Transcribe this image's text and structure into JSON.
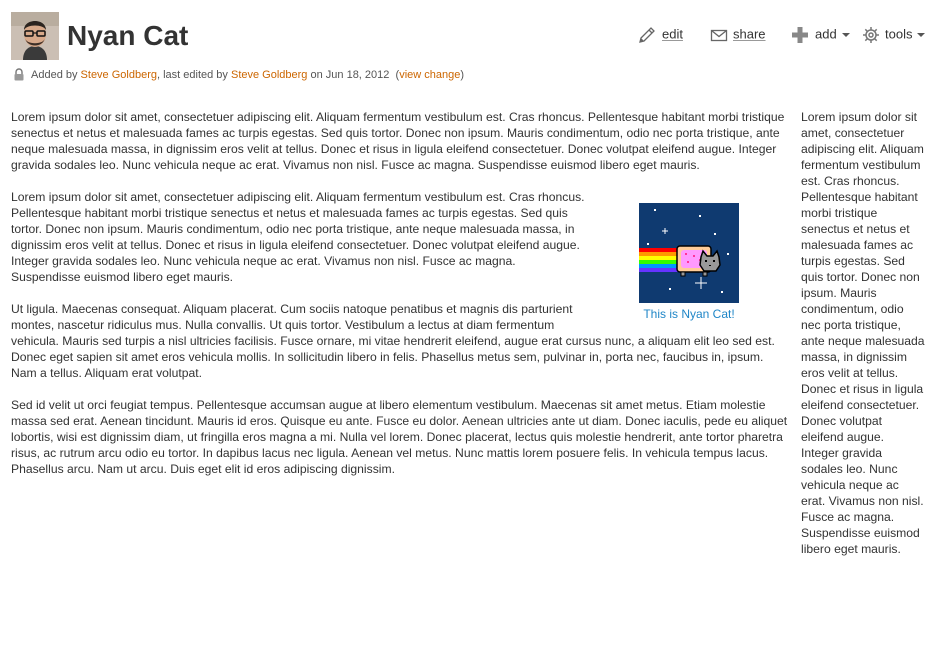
{
  "page": {
    "title": "Nyan Cat"
  },
  "byline": {
    "added_by_prefix": "Added by ",
    "added_by": "Steve Goldberg",
    "edited_by_prefix": ", last edited by ",
    "edited_by": "Steve Goldberg",
    "date_prefix": " on ",
    "date": "Jun 18, 2012",
    "open_paren": "  (",
    "view_change": "view change",
    "close_paren": ")"
  },
  "toolbar": {
    "edit_label": "edit",
    "share_label": "share",
    "add_label": "add",
    "tools_label": "tools"
  },
  "content": {
    "paragraphs": [
      "Lorem ipsum dolor sit amet, consectetuer adipiscing elit. Aliquam fermentum vestibulum est. Cras rhoncus. Pellentesque habitant morbi tristique senectus et netus et malesuada fames ac turpis egestas. Sed quis tortor. Donec non ipsum. Mauris condimentum, odio nec porta tristique, ante neque malesuada massa, in dignissim eros velit at tellus. Donec et risus in ligula eleifend consectetuer. Donec volutpat eleifend augue. Integer gravida sodales leo. Nunc vehicula neque ac erat. Vivamus non nisl. Fusce ac magna. Suspendisse euismod libero eget mauris.",
      "Lorem ipsum dolor sit amet, consectetuer adipiscing elit. Aliquam fermentum vestibulum est. Cras rhoncus. Pellentesque habitant morbi tristique senectus et netus et malesuada fames ac turpis egestas. Sed quis tortor. Donec non ipsum. Mauris condimentum, odio nec porta tristique, ante neque malesuada massa, in dignissim eros velit at tellus. Donec et risus in ligula eleifend consectetuer. Donec volutpat eleifend augue. Integer gravida sodales leo. Nunc vehicula neque ac erat. Vivamus non nisl. Fusce ac magna. Suspendisse euismod libero eget mauris.",
      "Ut ligula. Maecenas consequat. Aliquam placerat. Cum sociis natoque penatibus et magnis dis parturient montes, nascetur ridiculus mus. Nulla convallis. Ut quis tortor. Vestibulum a lectus at diam fermentum vehicula. Mauris sed turpis a nisl ultricies facilisis. Fusce ornare, mi vitae hendrerit eleifend, augue erat cursus nunc, a aliquam elit leo sed est. Donec eget sapien sit amet eros vehicula mollis. In sollicitudin libero in felis. Phasellus metus sem, pulvinar in, porta nec, faucibus in, ipsum. Nam a tellus. Aliquam erat volutpat.",
      "Sed id velit ut orci feugiat tempus. Pellentesque accumsan augue at libero elementum vestibulum. Maecenas sit amet metus. Etiam molestie massa sed erat. Aenean tincidunt. Mauris id eros. Quisque eu ante. Fusce eu dolor. Aenean ultricies ante ut diam. Donec iaculis, pede eu aliquet lobortis, wisi est dignissim diam, ut fringilla eros magna a mi. Nulla vel lorem. Donec placerat, lectus quis molestie hendrerit, ante tortor pharetra risus, ac rutrum arcu odio eu tortor. In dapibus lacus nec ligula. Aenean vel metus. Nunc mattis lorem posuere felis. In vehicula tempus lacus. Phasellus arcu. Nam ut arcu. Duis eget elit id eros adipiscing dignissim."
    ],
    "figure_caption": "This is Nyan Cat!"
  },
  "sidebar": {
    "text": "Lorem ipsum dolor sit amet, consectetuer adipiscing elit. Aliquam fermentum vestibulum est. Cras rhoncus. Pellentesque habitant morbi tristique senectus et netus et malesuada fames ac turpis egestas. Sed quis tortor. Donec non ipsum. Mauris condimentum, odio nec porta tristique, ante neque malesuada massa, in dignissim eros velit at tellus. Donec et risus in ligula eleifend consectetuer. Donec volutpat eleifend augue. Integer gravida sodales leo. Nunc vehicula neque ac erat. Vivamus non nisl. Fusce ac magna. Suspendisse euismod libero eget mauris."
  },
  "icons": {
    "avatar": "user-avatar",
    "lock": "lock-icon",
    "edit": "pencil-icon",
    "share": "envelope-icon",
    "add": "plus-icon",
    "tools": "gear-icon"
  },
  "colors": {
    "link": "#cc6600",
    "caption": "#1f86c7",
    "text": "#333333"
  }
}
